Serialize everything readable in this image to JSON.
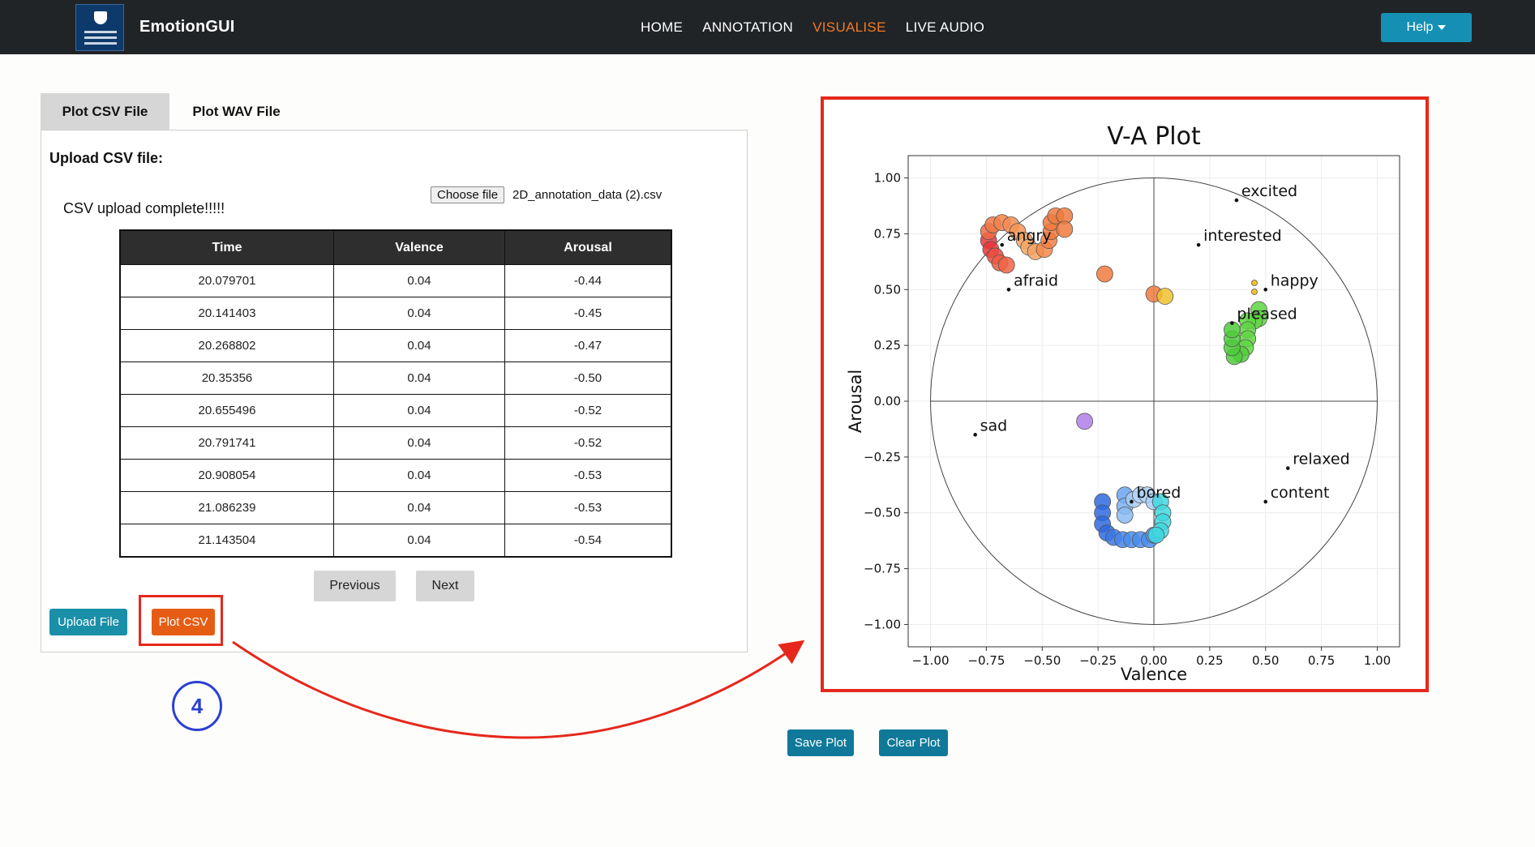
{
  "app": {
    "title": "EmotionGUI"
  },
  "nav": {
    "items": [
      "HOME",
      "ANNOTATION",
      "VISUALISE",
      "LIVE AUDIO"
    ],
    "active_index": 2,
    "help_label": "Help"
  },
  "tabs": [
    "Plot CSV File",
    "Plot WAV File"
  ],
  "upload": {
    "title": "Upload CSV file:",
    "choose_file_label": "Choose file",
    "file_name": "2D_annotation_data (2).csv",
    "status": "CSV upload complete!!!!!"
  },
  "table": {
    "columns": [
      "Time",
      "Valence",
      "Arousal"
    ],
    "rows": [
      [
        "20.079701",
        "0.04",
        "-0.44"
      ],
      [
        "20.141403",
        "0.04",
        "-0.45"
      ],
      [
        "20.268802",
        "0.04",
        "-0.47"
      ],
      [
        "20.35356",
        "0.04",
        "-0.50"
      ],
      [
        "20.655496",
        "0.04",
        "-0.52"
      ],
      [
        "20.791741",
        "0.04",
        "-0.52"
      ],
      [
        "20.908054",
        "0.04",
        "-0.53"
      ],
      [
        "21.086239",
        "0.04",
        "-0.53"
      ],
      [
        "21.143504",
        "0.04",
        "-0.54"
      ]
    ]
  },
  "pager": {
    "previous_label": "Previous",
    "next_label": "Next"
  },
  "actions": {
    "upload_label": "Upload File",
    "plot_label": "Plot CSV"
  },
  "step": {
    "number": "4"
  },
  "plot_actions": {
    "save_label": "Save Plot",
    "clear_label": "Clear Plot"
  },
  "colors": {
    "accent": "#f27a22",
    "highlight": "#e5281b",
    "step": "#2a3fd4",
    "primary_button": "#1a8fa8",
    "plot_button": "#e55d14"
  },
  "chart_data": {
    "type": "scatter",
    "title": "V-A Plot",
    "xlabel": "Valence",
    "ylabel": "Arousal",
    "xlim": [
      -1.1,
      1.1
    ],
    "ylim": [
      -1.1,
      1.1
    ],
    "xticks": [
      "−1.00",
      "−0.75",
      "−0.50",
      "−0.25",
      "0.00",
      "0.25",
      "0.50",
      "0.75",
      "1.00"
    ],
    "yticks": [
      "1.00",
      "0.75",
      "0.50",
      "0.25",
      "0.00",
      "−0.25",
      "−0.50",
      "−0.75",
      "−1.00"
    ],
    "grid": true,
    "unit_circle": true,
    "emotion_labels": [
      {
        "text": "excited",
        "x": 0.37,
        "y": 0.9
      },
      {
        "text": "interested",
        "x": 0.2,
        "y": 0.7
      },
      {
        "text": "angry",
        "x": -0.68,
        "y": 0.7
      },
      {
        "text": "afraid",
        "x": -0.65,
        "y": 0.5
      },
      {
        "text": "happy",
        "x": 0.5,
        "y": 0.5
      },
      {
        "text": "pleased",
        "x": 0.35,
        "y": 0.35
      },
      {
        "text": "sad",
        "x": -0.8,
        "y": -0.15
      },
      {
        "text": "relaxed",
        "x": 0.6,
        "y": -0.3
      },
      {
        "text": "bored",
        "x": -0.1,
        "y": -0.45
      },
      {
        "text": "content",
        "x": 0.5,
        "y": -0.45
      }
    ],
    "points": [
      {
        "x": -0.74,
        "y": 0.72,
        "color": "#e8363a"
      },
      {
        "x": -0.73,
        "y": 0.68,
        "color": "#e8363a"
      },
      {
        "x": -0.71,
        "y": 0.65,
        "color": "#ea4c3e"
      },
      {
        "x": -0.69,
        "y": 0.62,
        "color": "#ec5a40"
      },
      {
        "x": -0.66,
        "y": 0.61,
        "color": "#ee6446"
      },
      {
        "x": -0.74,
        "y": 0.76,
        "color": "#ee6a44"
      },
      {
        "x": -0.72,
        "y": 0.79,
        "color": "#f07845"
      },
      {
        "x": -0.68,
        "y": 0.8,
        "color": "#f3824a"
      },
      {
        "x": -0.64,
        "y": 0.79,
        "color": "#f48c52"
      },
      {
        "x": -0.61,
        "y": 0.76,
        "color": "#f39658"
      },
      {
        "x": -0.58,
        "y": 0.72,
        "color": "#f4a060"
      },
      {
        "x": -0.56,
        "y": 0.69,
        "color": "#f5a866"
      },
      {
        "x": -0.53,
        "y": 0.67,
        "color": "#f4a262"
      },
      {
        "x": -0.49,
        "y": 0.68,
        "color": "#f28a4a"
      },
      {
        "x": -0.47,
        "y": 0.72,
        "color": "#f28045"
      },
      {
        "x": -0.46,
        "y": 0.76,
        "color": "#f07a3e"
      },
      {
        "x": -0.46,
        "y": 0.8,
        "color": "#f07a3e"
      },
      {
        "x": -0.44,
        "y": 0.83,
        "color": "#f07a3e"
      },
      {
        "x": -0.4,
        "y": 0.83,
        "color": "#f07a3e"
      },
      {
        "x": -0.4,
        "y": 0.77,
        "color": "#f07a3e"
      },
      {
        "x": -0.22,
        "y": 0.57,
        "color": "#f07a3e"
      },
      {
        "x": 0.0,
        "y": 0.48,
        "color": "#f07a3e"
      },
      {
        "x": 0.05,
        "y": 0.47,
        "color": "#f2c12e"
      },
      {
        "x": 0.45,
        "y": 0.53,
        "color": "#f2c12e",
        "small": true
      },
      {
        "x": 0.45,
        "y": 0.49,
        "color": "#f2c12e",
        "small": true
      },
      {
        "x": 0.47,
        "y": 0.41,
        "color": "#5fd642"
      },
      {
        "x": 0.47,
        "y": 0.37,
        "color": "#5fd642"
      },
      {
        "x": 0.45,
        "y": 0.36,
        "color": "#5fd642"
      },
      {
        "x": 0.42,
        "y": 0.36,
        "color": "#5fd642"
      },
      {
        "x": 0.42,
        "y": 0.32,
        "color": "#5fd642"
      },
      {
        "x": 0.42,
        "y": 0.28,
        "color": "#5fd642"
      },
      {
        "x": 0.41,
        "y": 0.24,
        "color": "#5fd642"
      },
      {
        "x": 0.39,
        "y": 0.21,
        "color": "#4fcb3a"
      },
      {
        "x": 0.36,
        "y": 0.2,
        "color": "#4fcb3a"
      },
      {
        "x": 0.35,
        "y": 0.24,
        "color": "#4fcb3a"
      },
      {
        "x": 0.35,
        "y": 0.28,
        "color": "#4fcb3a"
      },
      {
        "x": 0.35,
        "y": 0.32,
        "color": "#4fcb3a"
      },
      {
        "x": -0.31,
        "y": -0.09,
        "color": "#b07ee8"
      },
      {
        "x": -0.23,
        "y": -0.45,
        "color": "#2f6ae0"
      },
      {
        "x": -0.23,
        "y": -0.5,
        "color": "#2f6ae0"
      },
      {
        "x": -0.23,
        "y": -0.55,
        "color": "#2f6ae0"
      },
      {
        "x": -0.21,
        "y": -0.59,
        "color": "#2f6ae0"
      },
      {
        "x": -0.18,
        "y": -0.61,
        "color": "#3a78e6"
      },
      {
        "x": -0.14,
        "y": -0.62,
        "color": "#4585ea"
      },
      {
        "x": -0.1,
        "y": -0.62,
        "color": "#4a8dec"
      },
      {
        "x": -0.06,
        "y": -0.62,
        "color": "#4a8dec"
      },
      {
        "x": -0.02,
        "y": -0.62,
        "color": "#4a8dec"
      },
      {
        "x": 0.0,
        "y": -0.6,
        "color": "#5a9aee"
      },
      {
        "x": -0.13,
        "y": -0.42,
        "color": "#6aa4ef"
      },
      {
        "x": -0.13,
        "y": -0.47,
        "color": "#7ab0f0"
      },
      {
        "x": -0.13,
        "y": -0.51,
        "color": "#8abbf2"
      },
      {
        "x": -0.09,
        "y": -0.44,
        "color": "#a8ccf6"
      },
      {
        "x": -0.06,
        "y": -0.42,
        "color": "#b0d2f7"
      },
      {
        "x": -0.03,
        "y": -0.42,
        "color": "#b0d2f7"
      },
      {
        "x": 0.0,
        "y": -0.45,
        "color": "#a8ccf6"
      },
      {
        "x": 0.03,
        "y": -0.45,
        "color": "#40d8e0"
      },
      {
        "x": 0.04,
        "y": -0.5,
        "color": "#40d8e0"
      },
      {
        "x": 0.04,
        "y": -0.54,
        "color": "#40d8e0"
      },
      {
        "x": 0.03,
        "y": -0.58,
        "color": "#40d8e0"
      },
      {
        "x": 0.01,
        "y": -0.6,
        "color": "#40d8e0"
      }
    ]
  }
}
